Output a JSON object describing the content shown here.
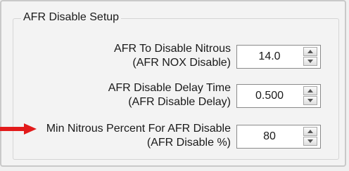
{
  "group": {
    "title": "AFR Disable Setup"
  },
  "fields": [
    {
      "label_line1": "AFR To Disable Nitrous",
      "label_line2": "(AFR NOX Disable)",
      "value": "14.0"
    },
    {
      "label_line1": "AFR Disable Delay Time",
      "label_line2": "(AFR Disable Delay)",
      "value": "0.500"
    },
    {
      "label_line1": "Min Nitrous Percent For AFR Disable",
      "label_line2": "(AFR Disable %)",
      "value": "80"
    }
  ],
  "colors": {
    "arrow": "#e21b1b",
    "background": "#f0f0f0"
  },
  "icons": {
    "spin_up": "chevron-up-icon",
    "spin_down": "chevron-down-icon",
    "pointer": "red-arrow-icon"
  }
}
